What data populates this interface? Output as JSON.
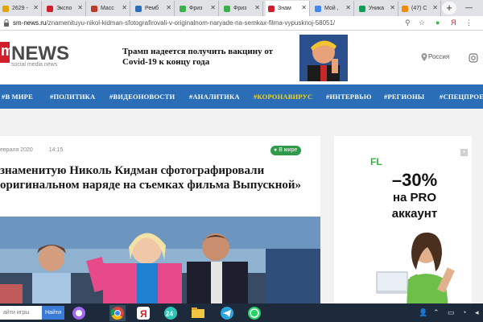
{
  "browser": {
    "tabs": [
      {
        "label": "2629 -",
        "color": "#e3a300"
      },
      {
        "label": "Экспо",
        "color": "#d11f2a"
      },
      {
        "label": "Масс",
        "color": "#c0392b"
      },
      {
        "label": "Ремб",
        "color": "#2a6eb7"
      },
      {
        "label": "Фриз",
        "color": "#37b34a"
      },
      {
        "label": "Фриз",
        "color": "#37b34a"
      },
      {
        "label": "Знам",
        "color": "#d11f2a"
      },
      {
        "label": "Мой ,",
        "color": "#4285f4"
      },
      {
        "label": "Уника",
        "color": "#0f9d58"
      },
      {
        "label": "(47) С",
        "color": "#f08a00"
      }
    ],
    "active_tab_index": 6,
    "new_tab": "+",
    "url_host": "sm-news.ru",
    "url_path": "/znamenituyu-nikol-kidman-sfotografirovali-v-originalnom-naryade-na-semkax-filma-vypusknoj-58051/"
  },
  "site": {
    "logo_m": "m",
    "logo_news": "NEWS",
    "logo_sub": "social media news",
    "teaser_headline": "Трамп надеется получить вакцину от Covid-19 к концу года",
    "region": "Россия"
  },
  "nav": [
    {
      "label": "#В МИРЕ"
    },
    {
      "label": "#ПОЛИТИКА"
    },
    {
      "label": "#ВИДЕОНОВОСТИ"
    },
    {
      "label": "#АНАЛИТИКА"
    },
    {
      "label": "#КОРОНАВИРУС",
      "highlight": true
    },
    {
      "label": "#ИНТЕРВЬЮ"
    },
    {
      "label": "#РЕГИОНЫ"
    },
    {
      "label": "#СПЕЦПРОЕ"
    }
  ],
  "article": {
    "date": "евраля 2020",
    "time": "14:15",
    "badge": "В мире",
    "title": "знаменитую Николь Кидман сфотографировали оригинальном наряде на съемках фильма Выпускной»"
  },
  "ad": {
    "logo": "FL",
    "discount": "–30%",
    "line2": "на PRO",
    "line3": "аккаунт",
    "close": "×"
  },
  "taskbar": {
    "search_placeholder": "айти игры",
    "search_button": "Найти"
  },
  "colors": {
    "nav_bg": "#2a6eb7",
    "accent_red": "#d11f2a",
    "highlight": "#f7d417",
    "badge_green": "#2f9b4a"
  }
}
